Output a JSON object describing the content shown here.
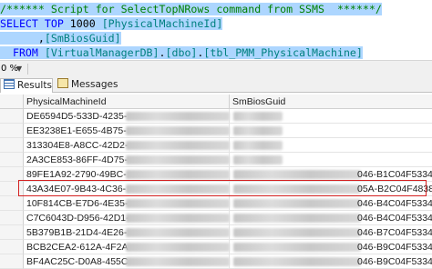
{
  "editor": {
    "lines": [
      {
        "parts": [
          {
            "t": "/****** Script for SelectTopNRows command from SSMS  ******/",
            "c": "cm"
          }
        ]
      },
      {
        "parts": [
          {
            "t": "SELECT TOP ",
            "c": "kw"
          },
          {
            "t": "1000 ",
            "c": ""
          },
          {
            "t": "[PhysicalMachineId]",
            "c": "id"
          }
        ]
      },
      {
        "parts": [
          {
            "t": "      ,",
            "c": ""
          },
          {
            "t": "[SmBiosGuid]",
            "c": "id"
          }
        ]
      },
      {
        "parts": [
          {
            "t": "  FROM ",
            "c": "kw"
          },
          {
            "t": "[VirtualManagerDB]",
            "c": "id"
          },
          {
            "t": ".",
            "c": ""
          },
          {
            "t": "[dbo]",
            "c": "id"
          },
          {
            "t": ".",
            "c": ""
          },
          {
            "t": "[tbl_PMM_PhysicalMachine]",
            "c": "id"
          }
        ]
      }
    ]
  },
  "zoom": {
    "value": "0 %"
  },
  "tabs": {
    "results": "Results",
    "messages": "Messages"
  },
  "grid": {
    "columns": [
      "PhysicalMachineId",
      "SmBiosGuid"
    ],
    "selected_row_number": "6",
    "rows": [
      {
        "num": "",
        "id": "DE6594D5-533D-4235-",
        "guid_end": ""
      },
      {
        "num": "",
        "id": "EE3238E1-E655-4B75-",
        "guid_end": ""
      },
      {
        "num": "",
        "id": "313304E8-A8CC-42D2-",
        "guid_end": ""
      },
      {
        "num": "",
        "id": "2A3CE853-86FF-4D75-",
        "guid_end": ""
      },
      {
        "num": "",
        "id": "89FE1A92-2790-49BC-",
        "guid_end": "046-B1C04F533432"
      },
      {
        "num": "",
        "id": "43A34E07-9B43-4C36-",
        "guid_end": "05A-B2C04F483832"
      },
      {
        "num": "",
        "id": "10F814CB-E7D6-4E35-",
        "guid_end": "046-B4C04F533432"
      },
      {
        "num": "",
        "id": "C7C6043D-D956-42D1-",
        "guid_end": "046-B4C04F533432"
      },
      {
        "num": "",
        "id": "5B379B1B-21D4-4E26-",
        "guid_end": "046-B7C04F533432"
      },
      {
        "num": "",
        "id": "BCB2CEA2-612A-4F2A-",
        "guid_end": "046-B9C04F533432"
      },
      {
        "num": "",
        "id": "BF4AC25C-D0A8-455C-",
        "guid_end": "046-B9C04F533432"
      }
    ]
  }
}
